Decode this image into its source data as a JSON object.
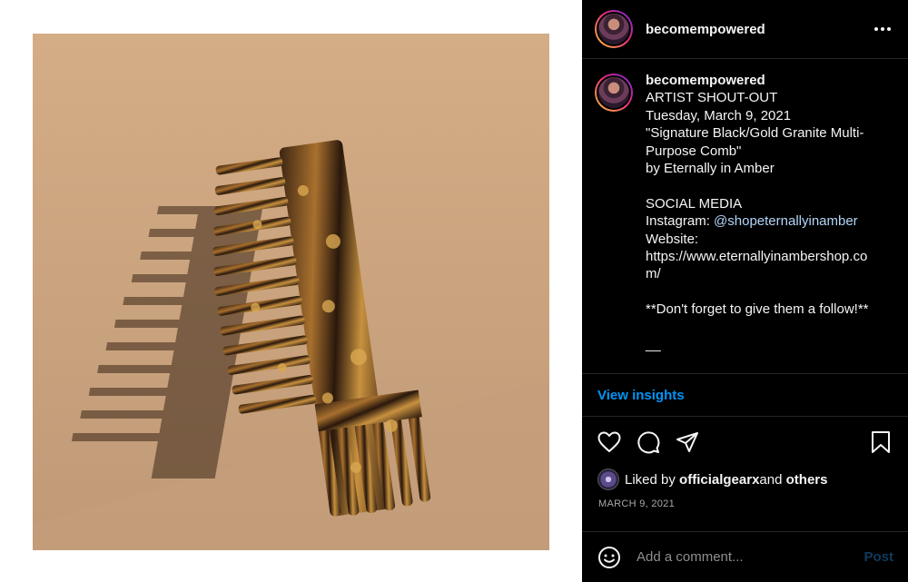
{
  "post": {
    "username": "becomempowered",
    "media_alt_icon": "comb-photo"
  },
  "caption": {
    "username": "becomempowered",
    "lines": [
      "ARTIST SHOUT-OUT",
      "Tuesday, March 9, 2021",
      "\"Signature Black/Gold Granite Multi-",
      "Purpose Comb\"",
      "by Eternally in Amber",
      "",
      "SOCIAL MEDIA"
    ],
    "instagram_label": "Instagram: ",
    "instagram_handle": "@shopeternallyinamber",
    "website_label": "Website:",
    "website_line1": "https://www.eternallyinambershop.co",
    "website_line2": "m/",
    "reminder": "**Don't forget to give them a follow!**",
    "divider": "__"
  },
  "insights": {
    "label": "View insights"
  },
  "likes": {
    "prefix": "Liked by ",
    "user": "officialgearx",
    "middle": " and ",
    "others": "others"
  },
  "date": "MARCH 9, 2021",
  "comment": {
    "placeholder": "Add a comment...",
    "post_label": "Post"
  },
  "colors": {
    "background": "#000000",
    "link": "#0095f6",
    "mention": "#b2d6f9",
    "muted": "#a8a8a8"
  }
}
